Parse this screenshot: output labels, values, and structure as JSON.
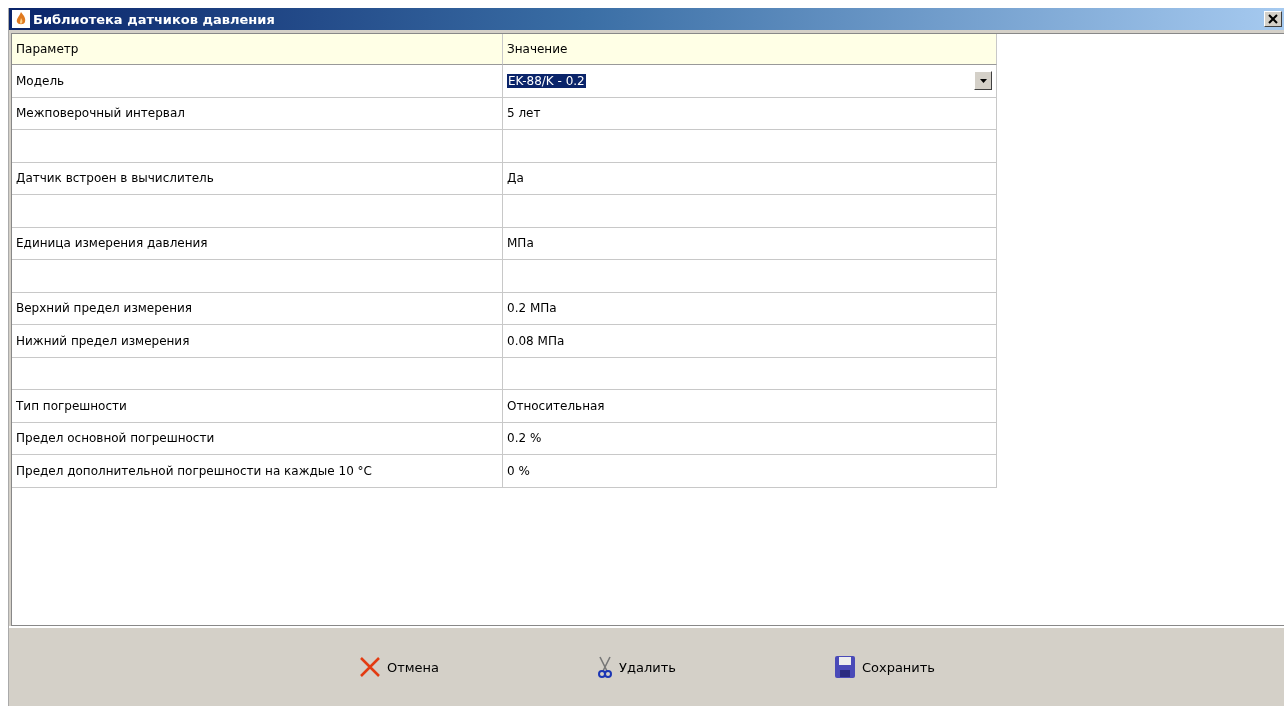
{
  "window": {
    "title": "Библиотека датчиков давления"
  },
  "table": {
    "columns": [
      "Параметр",
      "Значение"
    ],
    "rows": [
      {
        "kind": "dropdown",
        "parameter": "Модель",
        "value": "EK-88/K - 0.2",
        "selected": true
      },
      {
        "kind": "text",
        "parameter": "Межповерочный интервал",
        "value": "5 лет"
      },
      {
        "kind": "blank"
      },
      {
        "kind": "text",
        "parameter": "Датчик встроен в вычислитель",
        "value": "Да"
      },
      {
        "kind": "blank"
      },
      {
        "kind": "text",
        "parameter": "Единица измерения давления",
        "value": "МПа"
      },
      {
        "kind": "blank"
      },
      {
        "kind": "text",
        "parameter": "Верхний предел измерения",
        "value": "0.2 МПа"
      },
      {
        "kind": "text",
        "parameter": "Нижний предел измерения",
        "value": "0.08 МПа"
      },
      {
        "kind": "blank"
      },
      {
        "kind": "text",
        "parameter": "Тип погрешности",
        "value": "Относительная"
      },
      {
        "kind": "text",
        "parameter": "Предел основной погрешности",
        "value": "0.2 %"
      },
      {
        "kind": "text",
        "parameter": "Предел дополнительной погрешности на каждые 10 °C",
        "value": "0 %"
      }
    ]
  },
  "buttons": [
    {
      "kind": "cancel",
      "label": "Отмена"
    },
    {
      "kind": "delete",
      "label": "Удалить"
    },
    {
      "kind": "save",
      "label": "Сохранить"
    }
  ]
}
